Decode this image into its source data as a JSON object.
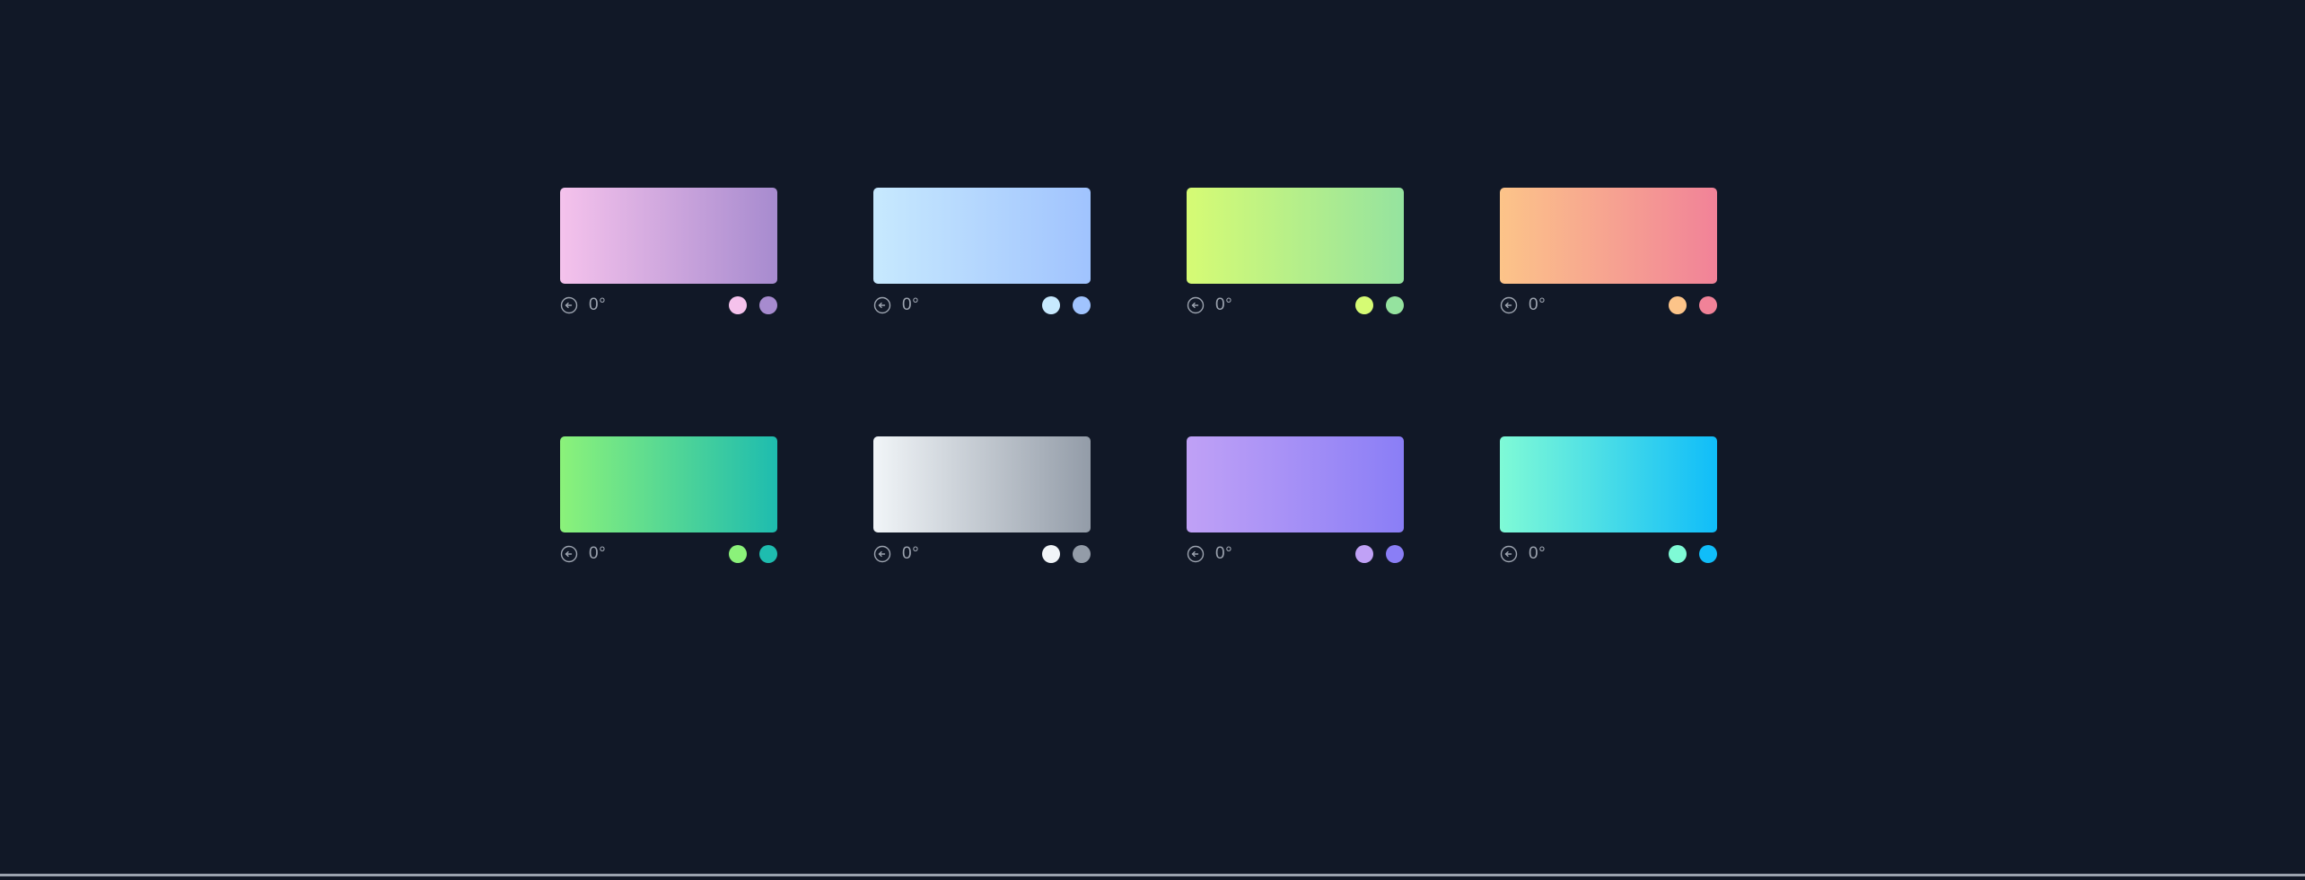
{
  "gradients": [
    {
      "angle": "0°",
      "icon": "rotate-icon",
      "from": "#f5c2ec",
      "to": "#a78bcf"
    },
    {
      "angle": "0°",
      "icon": "rotate-icon",
      "from": "#c7e9fe",
      "to": "#a0c3fe"
    },
    {
      "angle": "0°",
      "icon": "rotate-icon",
      "from": "#d6fb74",
      "to": "#95e39f"
    },
    {
      "angle": "0°",
      "icon": "rotate-icon",
      "from": "#fcc489",
      "to": "#f18298"
    },
    {
      "angle": "0°",
      "icon": "rotate-icon",
      "from": "#8bf27a",
      "to": "#1ebcaf"
    },
    {
      "angle": "0°",
      "icon": "rotate-icon",
      "from": "#f1f5f8",
      "to": "#939ca8"
    },
    {
      "angle": "0°",
      "icon": "rotate-icon",
      "from": "#c0a1f6",
      "to": "#8a7ef6"
    },
    {
      "angle": "0°",
      "icon": "rotate-icon",
      "from": "#7ffad6",
      "to": "#10bdf9"
    }
  ]
}
